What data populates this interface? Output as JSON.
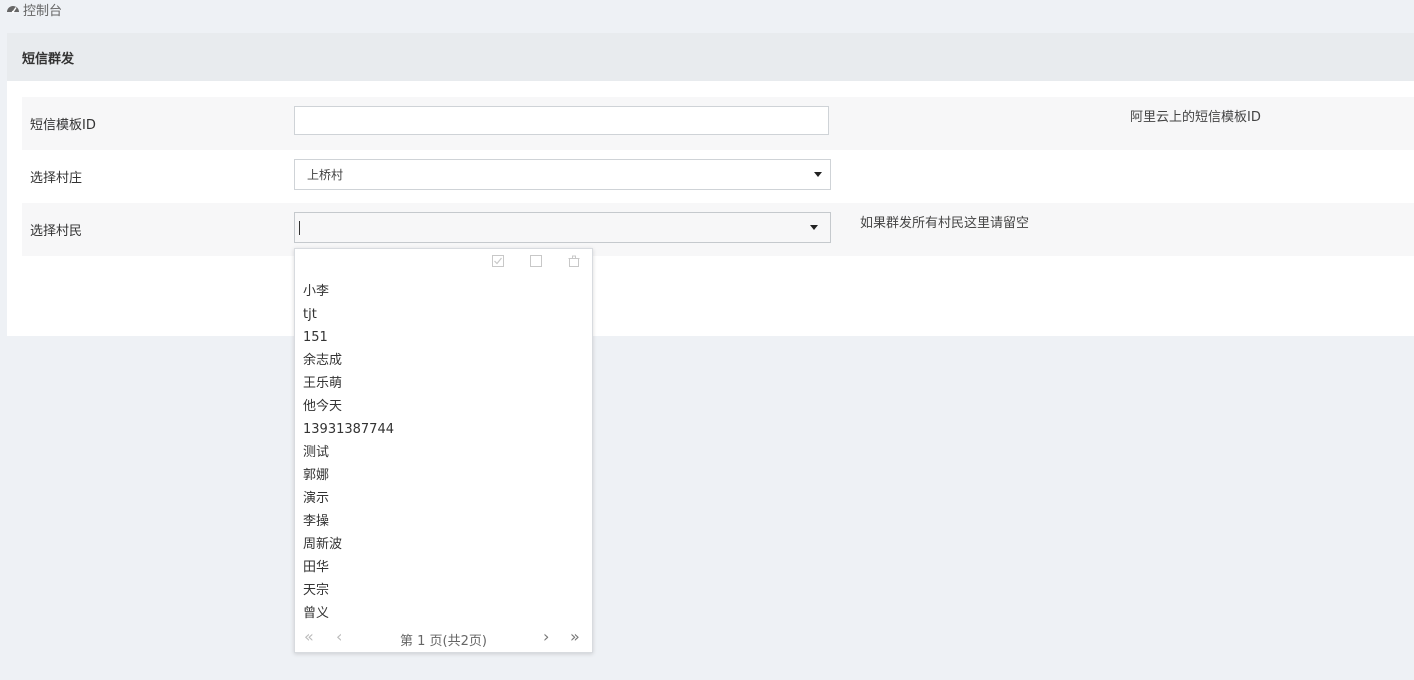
{
  "breadcrumb": {
    "icon": "dashboard-icon",
    "label": "控制台"
  },
  "panel": {
    "title": "短信群发"
  },
  "form": {
    "template_id": {
      "label": "短信模板ID",
      "value": "",
      "help": "阿里云上的短信模板ID"
    },
    "village": {
      "label": "选择村庄",
      "selected": "上桥村"
    },
    "villager": {
      "label": "选择村民",
      "value": "",
      "help": "如果群发所有村民这里请留空"
    }
  },
  "dropdown": {
    "tools": [
      "select-all-icon",
      "deselect-all-icon",
      "clear-icon"
    ],
    "options": [
      "小李",
      "tjt",
      "151",
      "余志成",
      "王乐萌",
      "他今天",
      "13931387744",
      "测试",
      "郭娜",
      "演示",
      "李操",
      "周新波",
      "田华",
      "天宗",
      "曾义"
    ],
    "pager": {
      "first": "«",
      "prev": "‹",
      "info": "第 1 页(共2页)",
      "next": "›",
      "last": "»"
    }
  },
  "colors": {
    "page_bg": "#eef1f5",
    "panel_heading_bg": "#e8ebee",
    "stripe_bg": "#f7f7f8"
  }
}
